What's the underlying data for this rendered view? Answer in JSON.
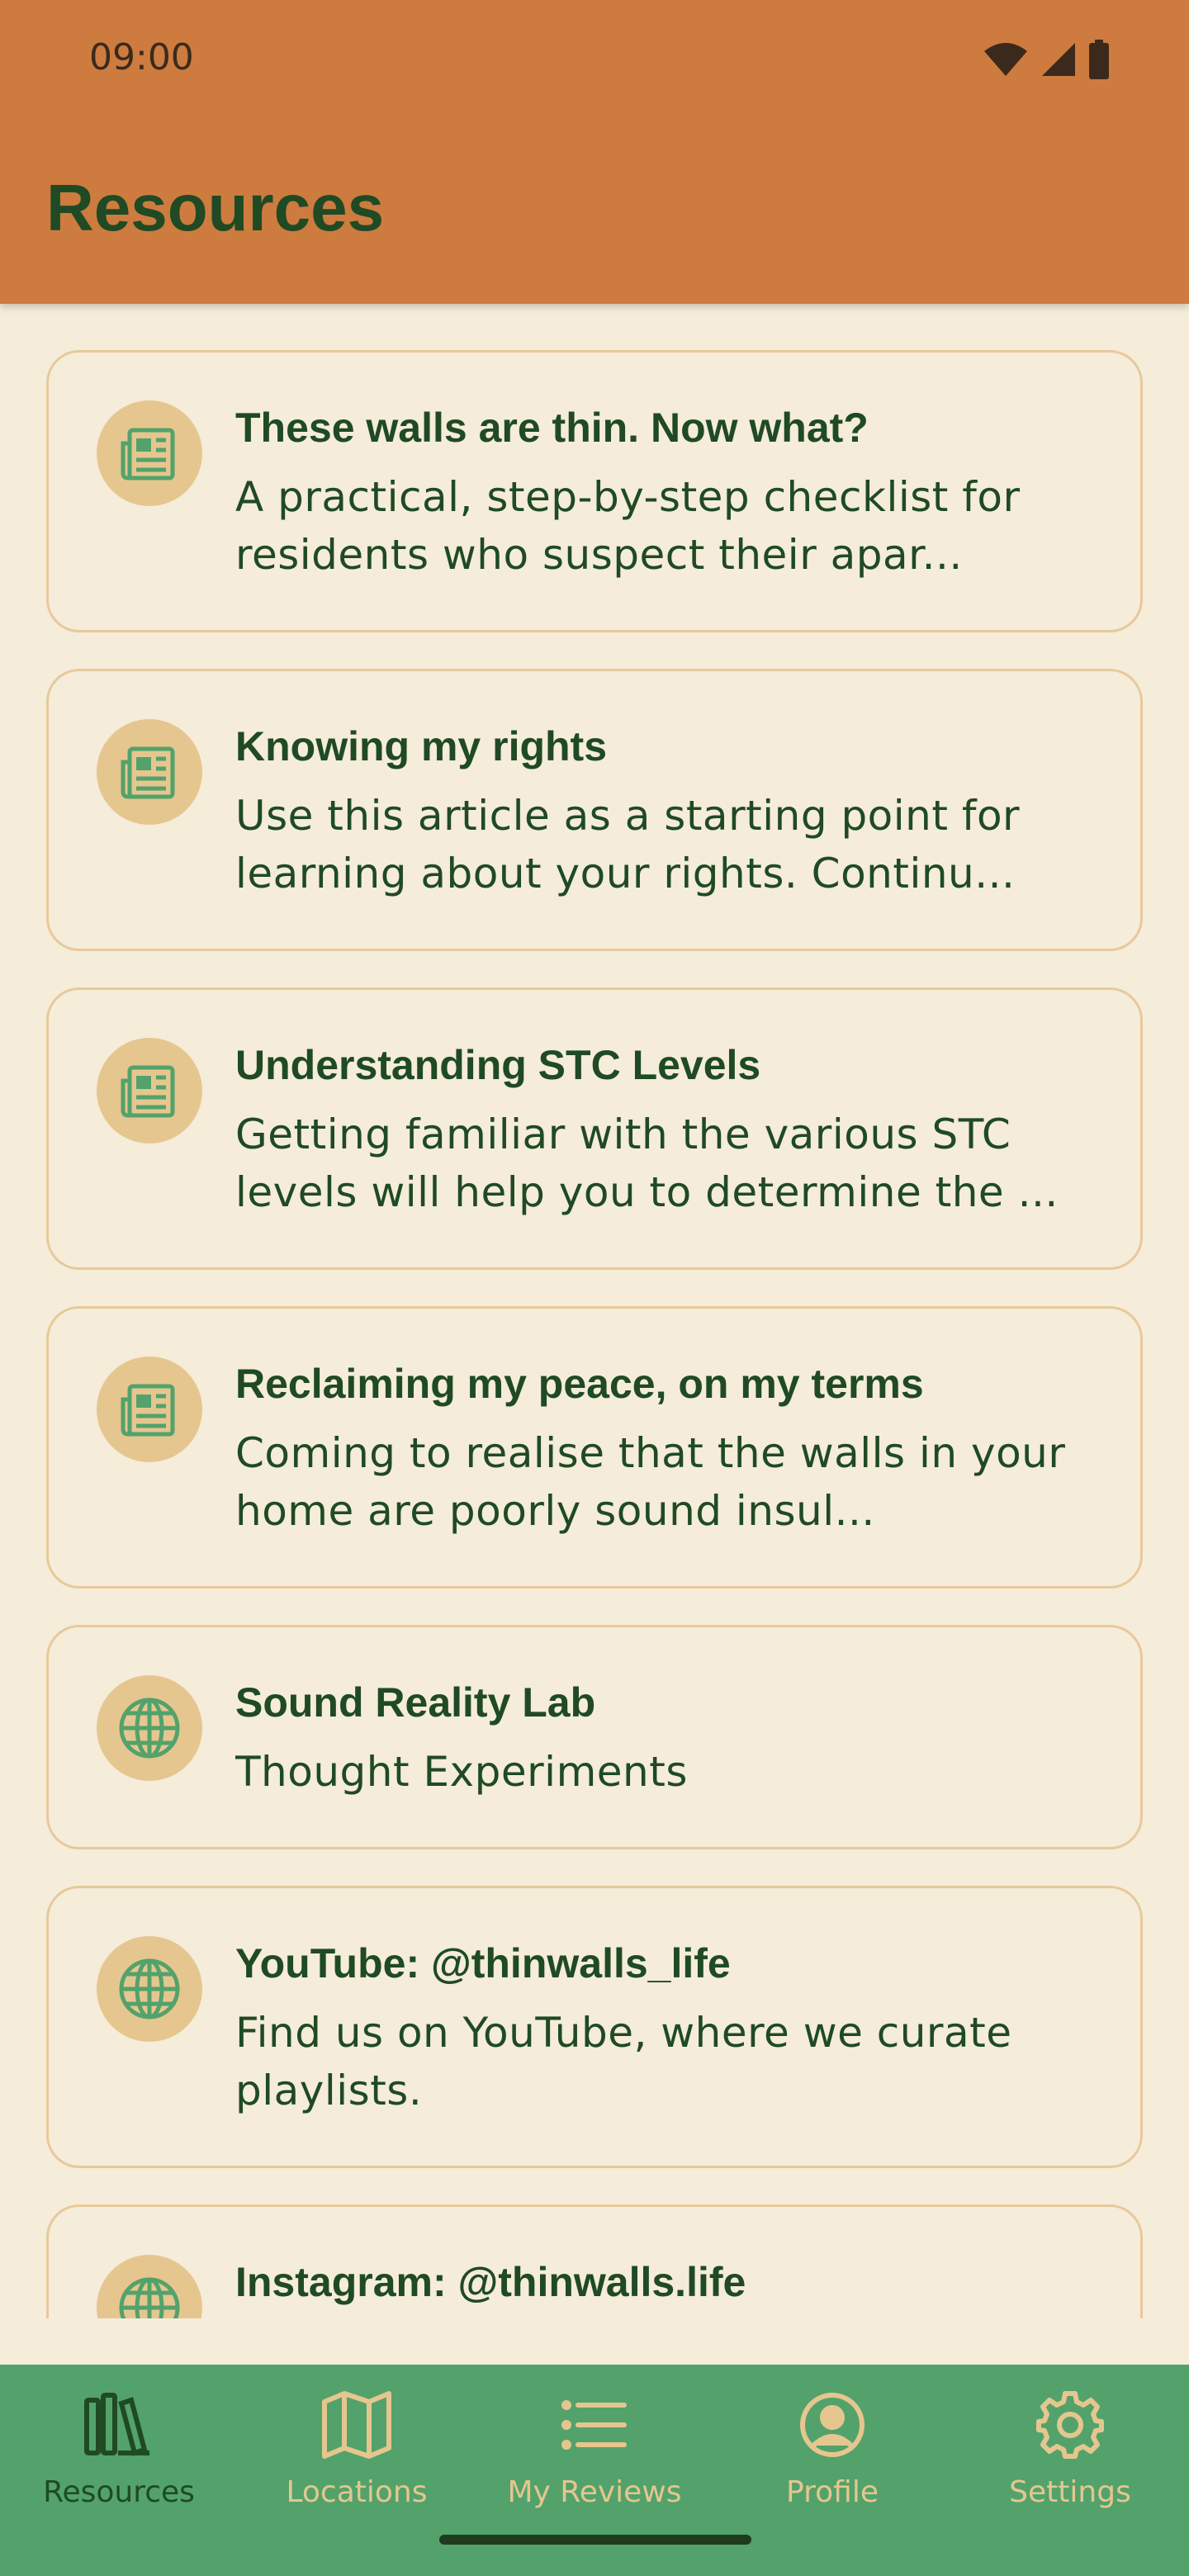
{
  "status_bar": {
    "time": "09:00"
  },
  "header": {
    "title": "Resources"
  },
  "resources": [
    {
      "icon": "article-icon",
      "title": "These walls are thin. Now what?",
      "description": "A practical, step-by-step checklist for residents who suspect their apar..."
    },
    {
      "icon": "article-icon",
      "title": "Knowing my rights",
      "description": "Use this article as a starting point for learning about your rights. Continu..."
    },
    {
      "icon": "article-icon",
      "title": "Understanding STC Levels",
      "description": "Getting familiar with the various STC levels will help you to determine the ..."
    },
    {
      "icon": "article-icon",
      "title": "Reclaiming my peace, on my terms",
      "description": "Coming to realise that the walls in your home are poorly sound insul..."
    },
    {
      "icon": "globe-icon",
      "title": "Sound Reality Lab",
      "description": "Thought Experiments"
    },
    {
      "icon": "globe-icon",
      "title": "YouTube: @thinwalls_life",
      "description": "Find us on YouTube, where we curate playlists."
    },
    {
      "icon": "globe-icon",
      "title": "Instagram: @thinwalls.life",
      "description": ""
    }
  ],
  "bottom_nav": [
    {
      "label": "Resources",
      "icon": "library-icon",
      "active": true
    },
    {
      "label": "Locations",
      "icon": "map-icon",
      "active": false
    },
    {
      "label": "My Reviews",
      "icon": "list-icon",
      "active": false
    },
    {
      "label": "Profile",
      "icon": "profile-icon",
      "active": false
    },
    {
      "label": "Settings",
      "icon": "gear-icon",
      "active": false
    }
  ],
  "colors": {
    "header": "#cd7b3f",
    "background": "#f5ecda",
    "card_border": "#e7c99a",
    "icon_circle": "#e6c68f",
    "text": "#1f4a24",
    "nav": "#53a26b"
  }
}
